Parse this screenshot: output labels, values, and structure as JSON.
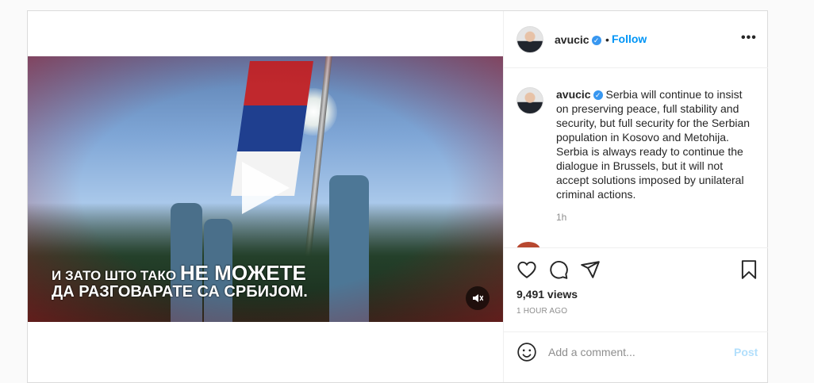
{
  "header": {
    "username": "avucic",
    "follow_label": "Follow",
    "dot": "•",
    "more_label": "•••"
  },
  "video": {
    "caption_line1_small": "И ЗАТО ШТО ТАКО",
    "caption_line1_big": "НЕ МОЖЕТЕ",
    "caption_line2": "ДА РАЗГОВАРАТЕ СА СРБИЈОМ."
  },
  "comment": {
    "username": "avucic",
    "text": "Serbia will continue to insist on preserving peace, full stability and security, but full security for the Serbian population in Kosovo and Metohija. Serbia is always ready to continue the dialogue in Brussels, but it will not accept solutions imposed by unilateral criminal actions.",
    "time": "1h",
    "next_comment_partial": "__________________"
  },
  "stats": {
    "views": "9,491 views",
    "posted_ago": "1 HOUR AGO"
  },
  "add_comment": {
    "placeholder": "Add a comment...",
    "post_label": "Post"
  }
}
